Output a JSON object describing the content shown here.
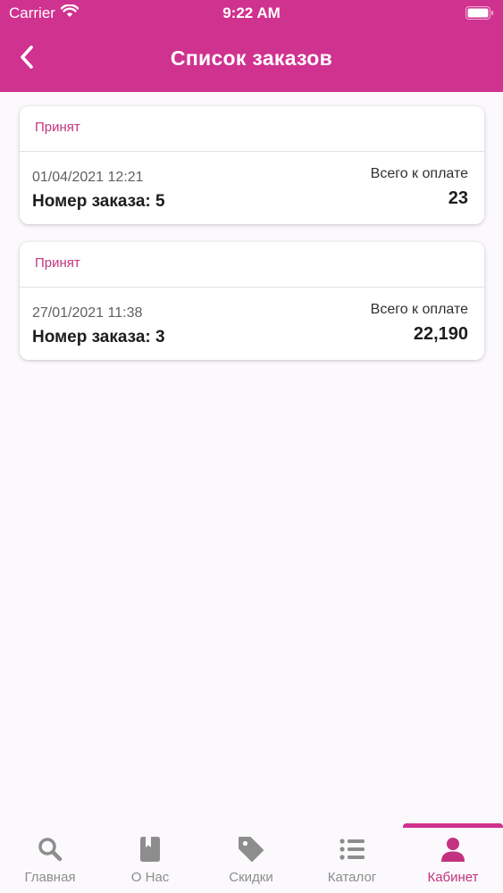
{
  "status_bar": {
    "carrier": "Carrier",
    "time": "9:22 AM"
  },
  "header": {
    "title": "Список заказов"
  },
  "orders": [
    {
      "status": "Принят",
      "date": "01/04/2021 12:21",
      "number": "Номер заказа: 5",
      "total_label": "Всего к оплате",
      "total": "23"
    },
    {
      "status": "Принят",
      "date": "27/01/2021 11:38",
      "number": "Номер заказа: 3",
      "total_label": "Всего к оплате",
      "total": "22,190"
    }
  ],
  "tabs": [
    {
      "label": "Главная",
      "icon": "search-icon",
      "active": false
    },
    {
      "label": "О Нас",
      "icon": "book-icon",
      "active": false
    },
    {
      "label": "Скидки",
      "icon": "tag-icon",
      "active": false
    },
    {
      "label": "Каталог",
      "icon": "list-icon",
      "active": false
    },
    {
      "label": "Кабинет",
      "icon": "person-icon",
      "active": true
    }
  ],
  "colors": {
    "accent": "#d0328f",
    "status": "#c2327f",
    "inactive": "#8d8d8d"
  }
}
